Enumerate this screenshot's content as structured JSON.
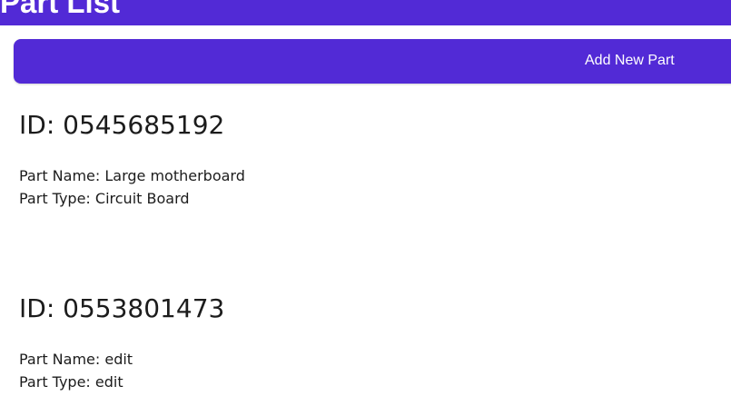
{
  "header": {
    "title": "Part List"
  },
  "toolbar": {
    "add_label": "Add New Part"
  },
  "parts": [
    {
      "id_prefix": "ID:",
      "id": "0545685192",
      "name_prefix": "Part Name:",
      "name": "Large motherboard",
      "type_prefix": "Part Type:",
      "type": "Circuit Board"
    },
    {
      "id_prefix": "ID:",
      "id": "0553801473",
      "name_prefix": "Part Name:",
      "name": "edit",
      "type_prefix": "Part Type:",
      "type": "edit"
    }
  ],
  "colors": {
    "accent": "#522ad6",
    "text": "#1c1c1c",
    "background": "#ffffff"
  }
}
